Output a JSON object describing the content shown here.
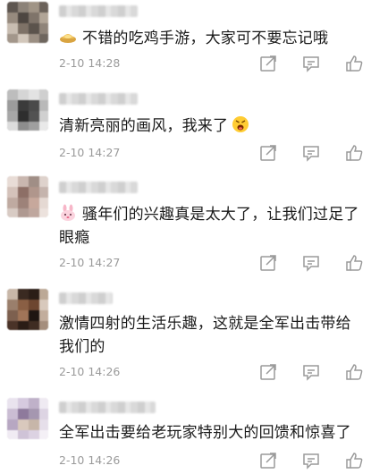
{
  "comments": [
    {
      "emoji": "gold-ingot-icon",
      "text": "不错的吃鸡手游，大家可不要忘记哦",
      "time": "2-10 14:28"
    },
    {
      "emoji": "angry-face-icon",
      "text": "清新亮丽的画风，我来了",
      "time": "2-10 14:27"
    },
    {
      "emoji": "pink-rabbit-icon",
      "text": "骚年们的兴趣真是太大了，让我们过足了眼瘾",
      "time": "2-10 14:27"
    },
    {
      "emoji": "",
      "text": "激情四射的生活乐趣，这就是全军出击带给我们的",
      "time": "2-10 14:26"
    },
    {
      "emoji": "",
      "text": "全军出击要给老玩家特别大的回馈和惊喜了",
      "time": "2-10 14:26"
    }
  ],
  "icons": {
    "share": "share-icon",
    "comment": "comment-icon",
    "like": "thumbs-up-icon"
  },
  "colors": {
    "text": "#1a1a1a",
    "time": "#9a9a9a",
    "icon": "#9a9a9a",
    "divider": "#efefef"
  }
}
